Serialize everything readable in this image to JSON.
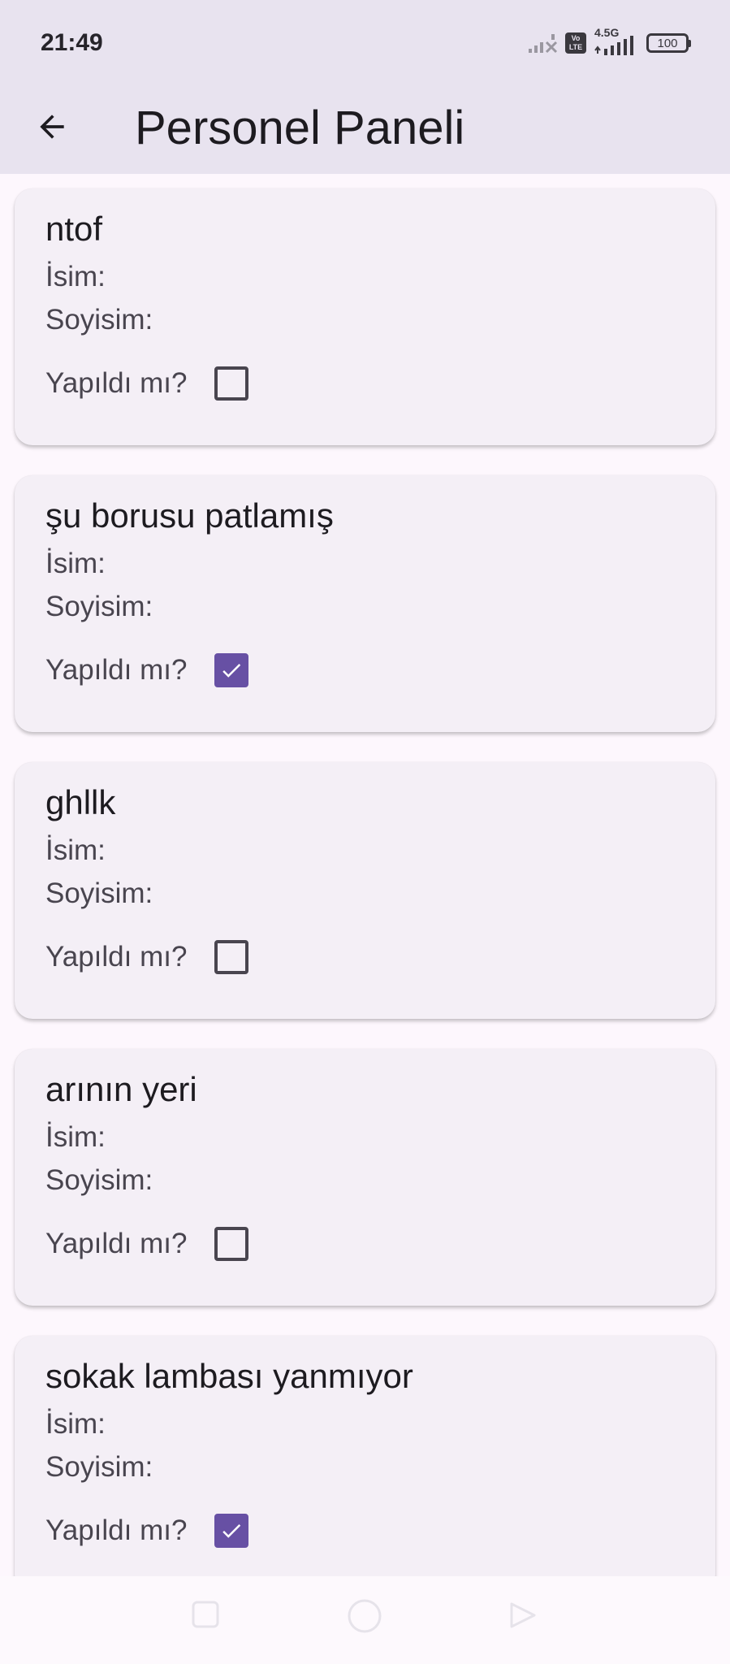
{
  "status_bar": {
    "time": "21:49",
    "network_type": "4.5G",
    "volte_label": "Vo LTE",
    "battery": "100"
  },
  "app_bar": {
    "title": "Personel Paneli",
    "back_icon": "arrow-left-icon"
  },
  "labels": {
    "name": "İsim:",
    "surname": "Soyisim:",
    "done": "Yapıldı mı?"
  },
  "tasks": [
    {
      "title": "ntof",
      "done": false
    },
    {
      "title": "şu borusu patlamış",
      "done": true
    },
    {
      "title": "ghllk",
      "done": false
    },
    {
      "title": "arının yeri",
      "done": false
    },
    {
      "title": "sokak lambası yanmıyor",
      "done": true
    }
  ],
  "colors": {
    "primary": "#6750a4",
    "app_bar_bg": "#e8e3ef",
    "card_bg": "#f4eff6",
    "page_bg": "#fdf7fd"
  },
  "nav_bar": {
    "recents_icon": "square-recents-icon",
    "home_icon": "circle-home-icon",
    "back_icon": "triangle-back-icon"
  }
}
